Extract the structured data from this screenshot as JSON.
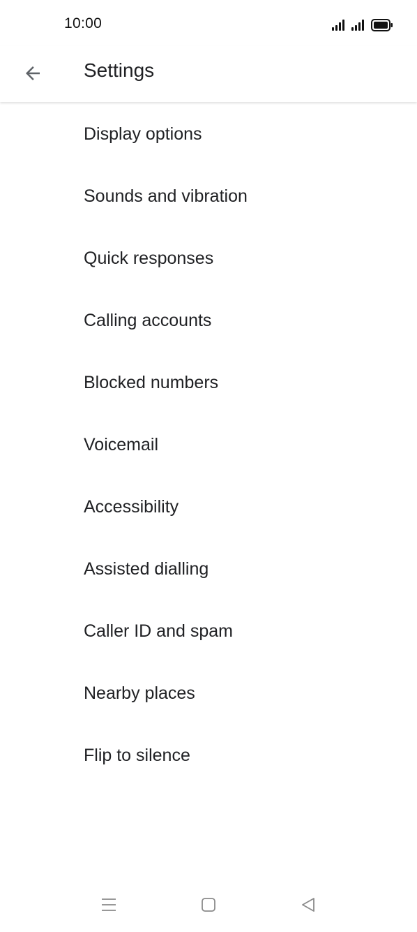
{
  "status_bar": {
    "time": "10:00"
  },
  "app_bar": {
    "title": "Settings",
    "back_icon": "arrow-back-icon"
  },
  "settings": {
    "items": [
      {
        "label": "Display options"
      },
      {
        "label": "Sounds and vibration"
      },
      {
        "label": "Quick responses"
      },
      {
        "label": "Calling accounts"
      },
      {
        "label": "Blocked numbers"
      },
      {
        "label": "Voicemail"
      },
      {
        "label": "Accessibility"
      },
      {
        "label": "Assisted dialling"
      },
      {
        "label": "Caller ID and spam"
      },
      {
        "label": "Nearby places"
      },
      {
        "label": "Flip to silence"
      }
    ]
  },
  "nav_bar": {
    "icons": [
      "menu-icon",
      "home-icon",
      "back-triangle-icon"
    ]
  },
  "colors": {
    "text": "#202124",
    "background": "#ffffff",
    "icon": "#5f6368"
  }
}
